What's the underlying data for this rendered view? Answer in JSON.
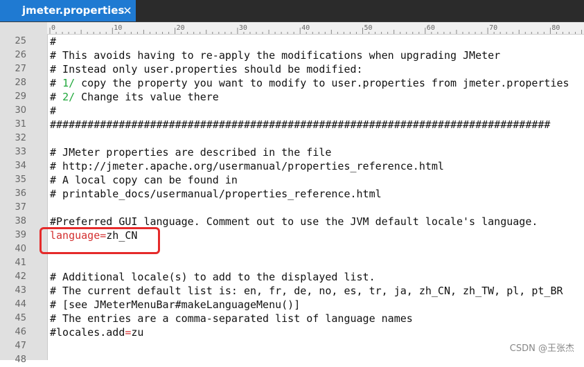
{
  "tab": {
    "title": "jmeter.properties",
    "close_icon": "✕"
  },
  "ruler": {
    "labels": [
      "0",
      "10",
      "20",
      "30",
      "40",
      "50",
      "60",
      "70",
      "80"
    ]
  },
  "lines": [
    {
      "num": "25",
      "parts": [
        {
          "t": "#",
          "c": "comment"
        }
      ]
    },
    {
      "num": "26",
      "parts": [
        {
          "t": "# This avoids having to re-apply the modifications when upgrading JMeter",
          "c": "comment"
        }
      ]
    },
    {
      "num": "27",
      "parts": [
        {
          "t": "# Instead only user.properties should be modified:",
          "c": "comment"
        }
      ]
    },
    {
      "num": "28",
      "parts": [
        {
          "t": "# ",
          "c": "comment"
        },
        {
          "t": "1/",
          "c": "green"
        },
        {
          "t": " copy the property you want to modify to user.properties from jmeter.properties",
          "c": "comment"
        }
      ]
    },
    {
      "num": "29",
      "parts": [
        {
          "t": "# ",
          "c": "comment"
        },
        {
          "t": "2/",
          "c": "green"
        },
        {
          "t": " Change its value there",
          "c": "comment"
        }
      ]
    },
    {
      "num": "30",
      "parts": [
        {
          "t": "#",
          "c": "comment"
        }
      ]
    },
    {
      "num": "31",
      "parts": [
        {
          "t": "################################################################################",
          "c": "comment"
        }
      ]
    },
    {
      "num": "32",
      "parts": []
    },
    {
      "num": "33",
      "parts": [
        {
          "t": "# JMeter properties are described in the file",
          "c": "comment"
        }
      ]
    },
    {
      "num": "34",
      "parts": [
        {
          "t": "# http://jmeter.apache.org/usermanual/properties_reference.html",
          "c": "comment"
        }
      ]
    },
    {
      "num": "35",
      "parts": [
        {
          "t": "# A local copy can be found in",
          "c": "comment"
        }
      ]
    },
    {
      "num": "36",
      "parts": [
        {
          "t": "# printable_docs/usermanual/properties_reference.html",
          "c": "comment"
        }
      ]
    },
    {
      "num": "37",
      "parts": []
    },
    {
      "num": "38",
      "parts": [
        {
          "t": "#Preferred GUI language. Comment out to use the JVM default locale's language.",
          "c": "comment"
        }
      ]
    },
    {
      "num": "39",
      "parts": [
        {
          "t": "language",
          "c": "key"
        },
        {
          "t": "=",
          "c": "key"
        },
        {
          "t": "zh_CN",
          "c": "val"
        }
      ]
    },
    {
      "num": "40",
      "parts": []
    },
    {
      "num": "41",
      "parts": []
    },
    {
      "num": "42",
      "parts": [
        {
          "t": "# Additional locale(s) to add to the displayed list.",
          "c": "comment"
        }
      ]
    },
    {
      "num": "43",
      "parts": [
        {
          "t": "# The current default list is: en, fr, de, no, es, tr, ja, zh_CN, zh_TW, pl, pt_BR",
          "c": "comment"
        }
      ]
    },
    {
      "num": "44",
      "parts": [
        {
          "t": "# [see JMeterMenuBar#makeLanguageMenu()]",
          "c": "comment"
        }
      ]
    },
    {
      "num": "45",
      "parts": [
        {
          "t": "# The entries are a comma-separated list of language names",
          "c": "comment"
        }
      ]
    },
    {
      "num": "46",
      "parts": [
        {
          "t": "#locales.add",
          "c": "comment"
        },
        {
          "t": "=",
          "c": "key"
        },
        {
          "t": "zu",
          "c": "comment"
        }
      ]
    },
    {
      "num": "47",
      "parts": []
    },
    {
      "num": "48",
      "parts": []
    }
  ],
  "watermark": "CSDN @王张杰"
}
